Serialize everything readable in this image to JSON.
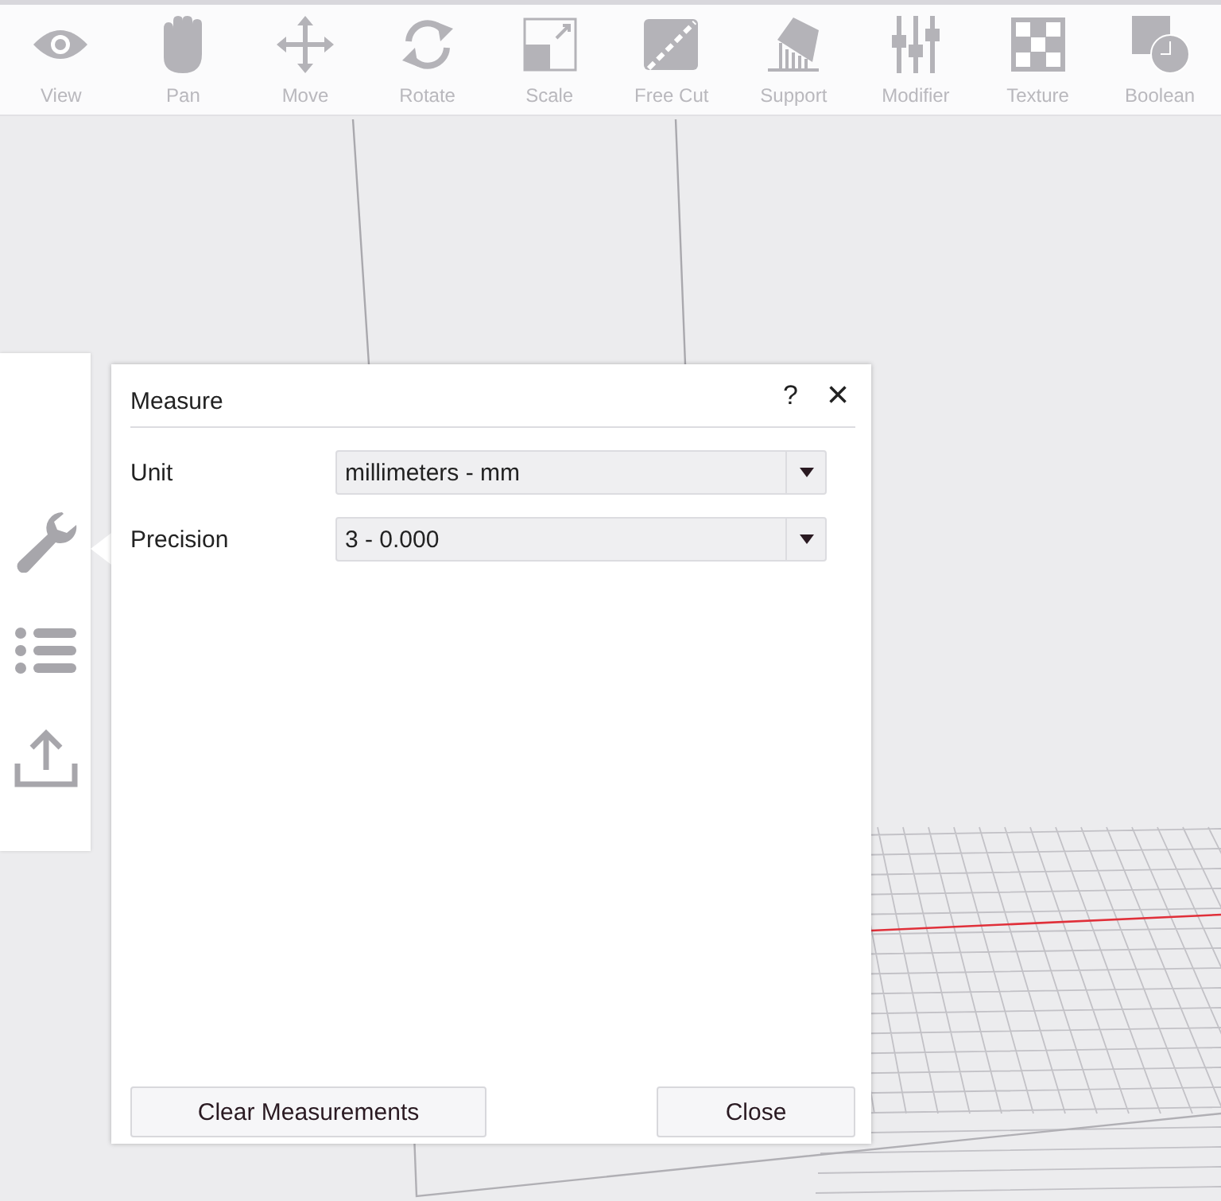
{
  "toolbar": {
    "tools": [
      {
        "label": "View"
      },
      {
        "label": "Pan"
      },
      {
        "label": "Move"
      },
      {
        "label": "Rotate"
      },
      {
        "label": "Scale"
      },
      {
        "label": "Free Cut"
      },
      {
        "label": "Support"
      },
      {
        "label": "Modifier"
      },
      {
        "label": "Texture"
      },
      {
        "label": "Boolean"
      }
    ]
  },
  "dialog": {
    "title": "Measure",
    "help": "?",
    "close_glyph": "×",
    "fields": [
      {
        "label": "Unit",
        "value": "millimeters - mm"
      },
      {
        "label": "Precision",
        "value": "3 - 0.000"
      }
    ],
    "buttons": [
      "Clear Measurements",
      "Close"
    ]
  }
}
